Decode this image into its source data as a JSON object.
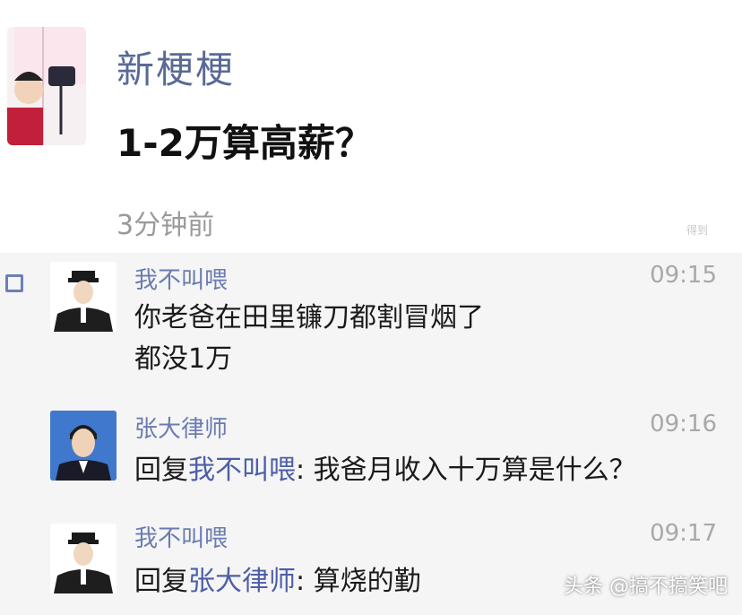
{
  "post": {
    "author": "新梗梗",
    "text": "1-2万算高薪？",
    "time": "3分钟前",
    "small_mark": "得到"
  },
  "comments": [
    {
      "author": "我不叫喂",
      "time": "09:15",
      "lines": [
        "你老爸在田里镰刀都割冒烟了",
        "都没1万"
      ],
      "avatar": "police-icon"
    },
    {
      "author": "张大律师",
      "time": "09:16",
      "reply_prefix": "回复",
      "reply_to": "我不叫喂",
      "reply_text": ": 我爸月收入十万算是什么？",
      "avatar": "portrait-icon"
    },
    {
      "author": "我不叫喂",
      "time": "09:17",
      "reply_prefix": "回复",
      "reply_to": "张大律师",
      "reply_text": ": 算烧的勤",
      "avatar": "police-icon"
    }
  ],
  "watermark": "头条 @搞不搞笑吧",
  "colors": {
    "name": "#6a7cb0",
    "reply_target": "#4c5fa6",
    "comments_bg": "#f5f5f5"
  }
}
